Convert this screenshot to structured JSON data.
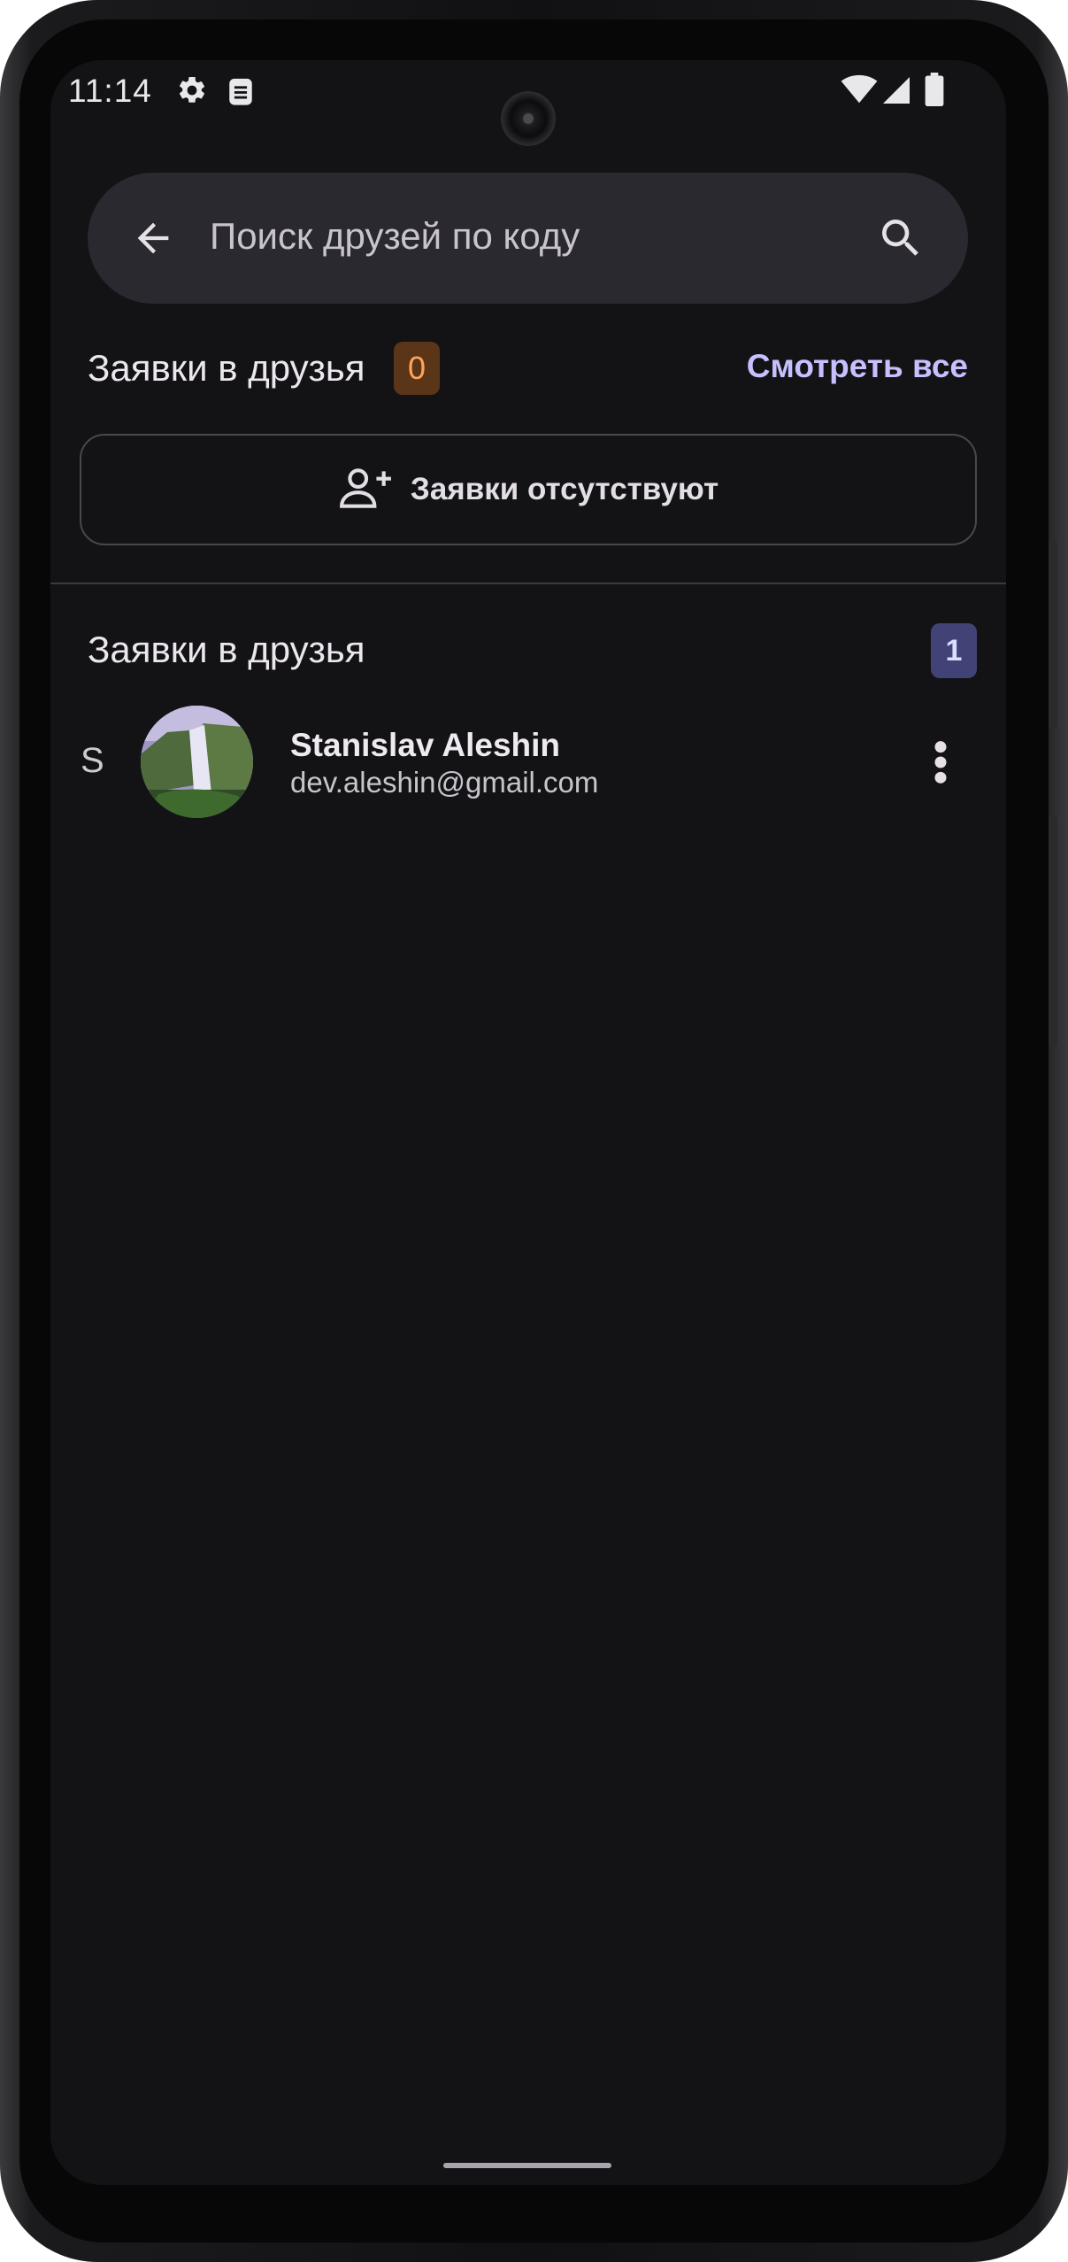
{
  "status_bar": {
    "time": "11:14",
    "icons": [
      "gear-icon",
      "clipboard-icon",
      "wifi-icon",
      "signal-icon",
      "battery-icon"
    ]
  },
  "search": {
    "placeholder": "Поиск друзей по коду"
  },
  "incoming_requests": {
    "title": "Заявки в друзья",
    "count": "0",
    "see_all": "Смотреть все",
    "empty_text": "Заявки отсутствуют"
  },
  "friends_section": {
    "title": "Заявки в друзья",
    "count": "1",
    "items": [
      {
        "letter": "S",
        "name": "Stanislav Aleshin",
        "email": "dev.aleshin@gmail.com"
      }
    ]
  },
  "colors": {
    "background": "#131316",
    "accent": "#c7c0ff",
    "badge_orange": "#ffa45a",
    "badge_purple_bg": "#414275"
  }
}
